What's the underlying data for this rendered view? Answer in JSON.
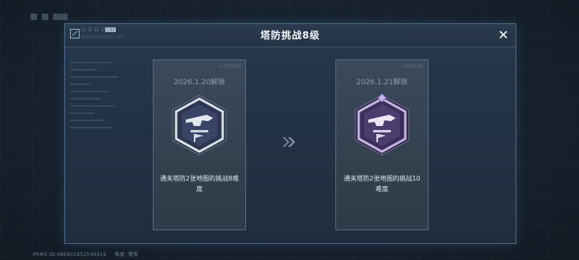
{
  "background": {
    "header_text": "□□□□"
  },
  "dialog": {
    "title": "塔防挑战8级",
    "header_code": "□ □ □ □ -",
    "header_badge": "□□",
    "header_sub": "□□□□□□□□□□ □□",
    "close_icon": "✕"
  },
  "cards": [
    {
      "tag": "△ □□□ □□",
      "date": "2026.1.20解锁",
      "description": "通关塔防2张地图的挑战8难度",
      "medal_style": "silver"
    },
    {
      "tag": "△ □□□ □□",
      "date": "2026.1.21解锁",
      "description": "通关塔防2张地图的挑战10难度",
      "medal_style": "purple"
    }
  ],
  "arrow_icon": "double-chevron-right-icon",
  "footer": {
    "id_text": "PRMS ID:486902952549419",
    "extra": "难度: 精英"
  },
  "colors": {
    "silver_medal": "#cdd6de",
    "purple_medal": "#b8a6d6",
    "accent": "#7fa3c2"
  }
}
